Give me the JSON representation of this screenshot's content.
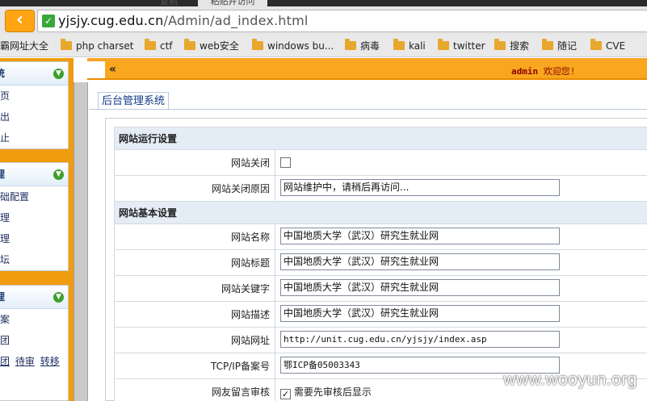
{
  "browser": {
    "tabs": [
      "复制",
      "粘贴并访问"
    ],
    "url_host": "yjsjy.cug.edu.cn",
    "url_path": "/Admin/ad_index.html",
    "bookmarks": [
      "霸网址大全",
      "php charset",
      "ctf",
      "web安全",
      "windows bu...",
      "病毒",
      "kali",
      "twitter",
      "搜索",
      "随记",
      "CVE"
    ]
  },
  "topbar": {
    "admin_name": "admin",
    "welcome_suffix": "欢迎您!"
  },
  "sidebar": {
    "group1": {
      "title": "统",
      "items": [
        "页",
        "出",
        "止"
      ]
    },
    "group2": {
      "title": "理",
      "items": [
        "础配置",
        "理",
        "理",
        "坛"
      ]
    },
    "group3": {
      "title": "理",
      "items": [
        "案",
        "团"
      ],
      "links": [
        "团",
        "待审",
        "转移"
      ]
    }
  },
  "content": {
    "tab_title": "后台管理系统",
    "section1_title": "网站运行设置",
    "section2_title": "网站基本设置",
    "rows": {
      "site_closed_label": "网站关闭",
      "close_reason_label": "网站关闭原因",
      "close_reason_value": "网站维护中，请稍后再访问...",
      "site_name_label": "网站名称",
      "site_name_value": "中国地质大学（武汉）研究生就业网",
      "site_title_label": "网站标题",
      "site_title_value": "中国地质大学（武汉）研究生就业网",
      "keywords_label": "网站关键字",
      "keywords_value": "中国地质大学（武汉）研究生就业网",
      "desc_label": "网站描述",
      "desc_value": "中国地质大学（武汉）研究生就业网",
      "url_label": "网站网址",
      "url_value": "http://unit.cug.edu.cn/yjsjy/index.asp",
      "icp_label": "TCP/IP备案号",
      "icp_value": "鄂ICP备05003343",
      "review_label": "网友留言审核",
      "review_value": "需要先审核后显示"
    }
  },
  "watermark": "www.wooyun.org"
}
